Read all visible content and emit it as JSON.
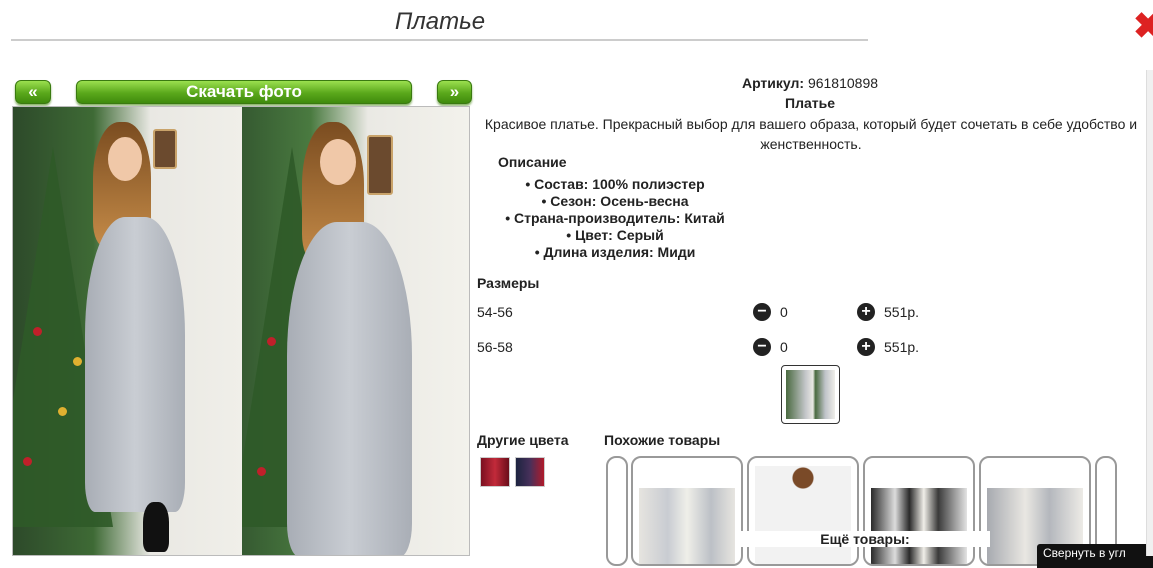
{
  "header": {
    "title": "Платье"
  },
  "gallery": {
    "prev_label": "«",
    "next_label": "»",
    "download_label": "Скачать фото"
  },
  "product": {
    "sku_label": "Артикул:",
    "sku_value": "961810898",
    "title": "Платье",
    "description": "Красивое платье. Прекрасный выбор для вашего образа, который будет сочетать в себе удобство и женственность.",
    "props_heading": "Описание",
    "props": [
      "Состав: 100% полиэстер",
      "Сезон: Осень-весна",
      "Страна-производитель: Китай",
      "Цвет: Серый",
      "Длина изделия: Миди"
    ]
  },
  "sizes": {
    "heading": "Размеры",
    "rows": [
      {
        "name": "54-56",
        "qty": "0",
        "price": "551р."
      },
      {
        "name": "56-58",
        "qty": "0",
        "price": "551р."
      }
    ]
  },
  "other_colors": {
    "heading": "Другие цвета"
  },
  "similar": {
    "heading": "Похожие товары",
    "more_label": "Ещё товары:"
  },
  "tooltip": {
    "text": "Свернуть в угл"
  },
  "colors": {
    "button_green": "#5aa81b",
    "close_red": "#dd2222"
  }
}
